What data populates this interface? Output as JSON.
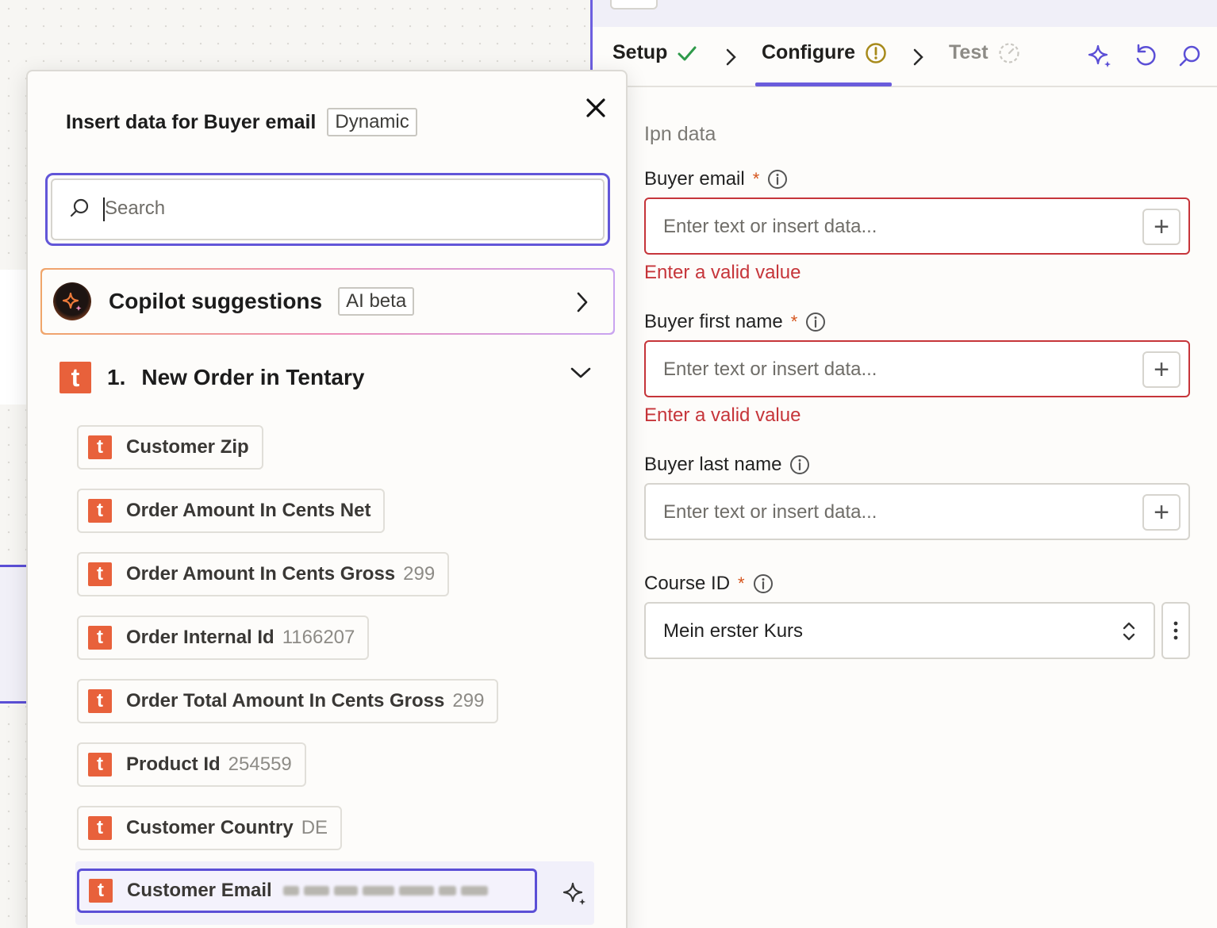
{
  "tabs": {
    "setup": "Setup",
    "configure": "Configure",
    "test": "Test"
  },
  "form": {
    "section": "Ipn data",
    "buyer_email": {
      "label": "Buyer email",
      "required": "*",
      "placeholder": "Enter text or insert data...",
      "error": "Enter a valid value"
    },
    "buyer_first_name": {
      "label": "Buyer first name",
      "required": "*",
      "placeholder": "Enter text or insert data...",
      "error": "Enter a valid value"
    },
    "buyer_last_name": {
      "label": "Buyer last name",
      "placeholder": "Enter text or insert data..."
    },
    "course_id": {
      "label": "Course ID",
      "required": "*",
      "value": "Mein erster Kurs"
    },
    "plus": "+"
  },
  "popup": {
    "title": "Insert data for Buyer email",
    "badge": "Dynamic",
    "search_placeholder": "Search",
    "copilot": {
      "label": "Copilot suggestions",
      "badge": "AI beta"
    },
    "group": {
      "number": "1.",
      "title": "New Order in Tentary",
      "logo": "t"
    },
    "items": [
      {
        "label": "Customer Zip",
        "value": ""
      },
      {
        "label": "Order Amount In Cents Net",
        "value": ""
      },
      {
        "label": "Order Amount In Cents Gross",
        "value": "299"
      },
      {
        "label": "Order Internal Id",
        "value": "1166207"
      },
      {
        "label": "Order Total Amount In Cents Gross",
        "value": "299"
      },
      {
        "label": "Product Id",
        "value": "254559"
      },
      {
        "label": "Customer Country",
        "value": "DE"
      },
      {
        "label": "Customer Email",
        "value": ""
      }
    ]
  },
  "colors": {
    "accent": "#6256d8",
    "error": "#c6353a",
    "tentary": "#e8613b",
    "required": "#d5541c"
  }
}
